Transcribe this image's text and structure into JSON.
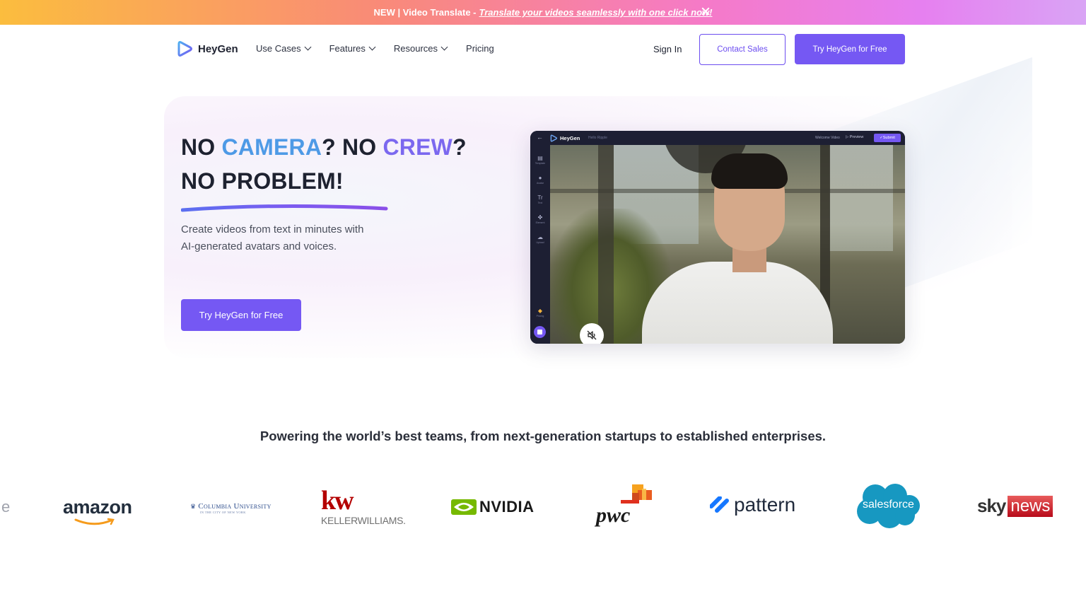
{
  "announcement": {
    "prefix": "NEW | Video Translate - ",
    "link": "Translate your videos seamlessly with one click now!"
  },
  "nav": {
    "brand": "HeyGen",
    "menu": [
      "Use Cases",
      "Features",
      "Resources",
      "Pricing"
    ],
    "sign_in": "Sign In",
    "contact_sales": "Contact Sales",
    "try_free": "Try HeyGen for Free"
  },
  "hero": {
    "line1_a": "NO ",
    "line1_b": "CAMERA",
    "line1_c": "? NO ",
    "line1_d": "CREW",
    "line1_e": "?",
    "line2": "NO PROBLEM!",
    "sub_line1": "Create videos from text in minutes with",
    "sub_line2": "AI-generated avatars and voices.",
    "cta": "Try HeyGen for Free"
  },
  "app_preview": {
    "brand": "HeyGen",
    "project": "Hello Ripple",
    "doc_name": "Welcome Video",
    "preview": "Preview",
    "submit": "Submit",
    "sidebar": [
      "Template",
      "Avatar",
      "Text",
      "Element",
      "Upload"
    ],
    "pricing": "Pricing"
  },
  "trust": {
    "heading": "Powering the world’s best teams, from next-generation startups to established enterprises."
  },
  "logos": {
    "partial": "e",
    "amazon": "amazon",
    "columbia_main": "Columbia University",
    "columbia_sub": "IN THE CITY OF NEW YORK",
    "kw_mark": "kw",
    "kw_text": "KELLERWILLIAMS.",
    "nvidia": "NVIDIA",
    "pwc": "pwc",
    "pattern": "pattern",
    "salesforce": "salesforce",
    "sky": "sky",
    "news": "news"
  },
  "colors": {
    "accent": "#7558f3",
    "camera_blue": "#4e9ae6",
    "crew_purple": "#7b68ef"
  }
}
